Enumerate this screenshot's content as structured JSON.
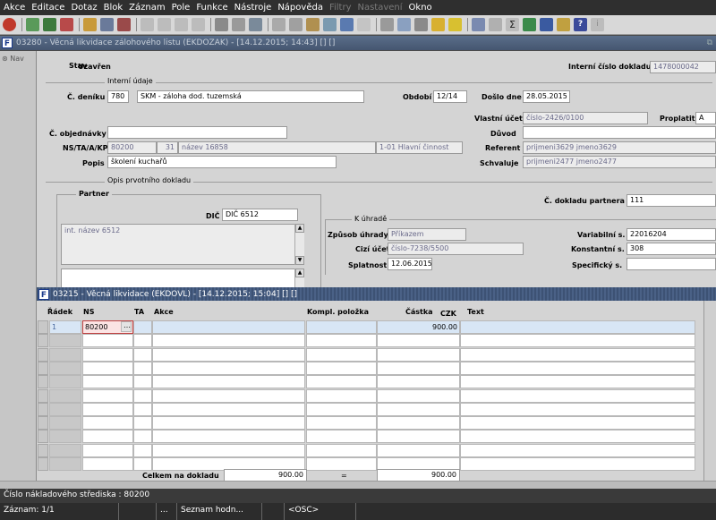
{
  "menu": [
    "Akce",
    "Editace",
    "Dotaz",
    "Blok",
    "Záznam",
    "Pole",
    "Funkce",
    "Nástroje",
    "Nápověda",
    "Filtry",
    "Nastavení",
    "Okno"
  ],
  "menu_disabled": [
    "Filtry",
    "Nastavení"
  ],
  "outer_window": {
    "title": "03280 - Věcná likvidace zálohového listu (EKDOZAK) - [14.12.2015; 14:43] [] []"
  },
  "nav": {
    "label": "Nav"
  },
  "form": {
    "stav_label": "Stav",
    "stav_value": "Uzavřen",
    "interni_cislo_label": "Interní číslo dokladu",
    "interni_cislo_value": "1478000042",
    "interni_udaje_label": "Interní údaje",
    "cislo_deniku_label": "Č. deníku",
    "cislo_deniku_value": "780",
    "denik_nazev": "SKM - záloha dod. tuzemská",
    "obdobi_label": "Období",
    "obdobi_value": "12/14",
    "doslo_dne_label": "Došlo dne",
    "doslo_dne_value": "28.05.2015",
    "vlastni_ucet_label": "Vlastní účet",
    "vlastni_ucet_value": "číslo-2426/0100",
    "proplatit_label": "Proplatit",
    "proplatit_value": "A",
    "objednavky_label": "Č. objednávky",
    "objednavky_value": "",
    "duvod_label": "Důvod",
    "duvod_value": "",
    "ns_label": "NS/TA/A/KP",
    "ns_value": "80200",
    "ta_value": "31",
    "a_value": "název 16858",
    "kp_value": "1-01 Hlavní činnost",
    "referent_label": "Referent",
    "referent_value": "prijmeni3629 jmeno3629",
    "popis_label": "Popis",
    "popis_value": "školení kuchařů",
    "schvaluje_label": "Schvaluje",
    "schvaluje_value": "prijmeni2477 jmeno2477",
    "opis_label": "Opis prvotního dokladu",
    "partner_label": "Partner",
    "cislo_partnera_label": "Č. dokladu partnera",
    "cislo_partnera_value": "111",
    "dic_label": "DIČ",
    "dic_value": "DIČ 6512",
    "partner_nazev": "int. název 6512",
    "k_uhrade_label": "K úhradě",
    "zpusob_label": "Způsob úhrady",
    "zpusob_value": "Příkazem",
    "cizi_ucet_label": "Cizí účet",
    "cizi_ucet_value": "číslo-7238/5500",
    "splatnost_label": "Splatnost",
    "splatnost_value": "12.06.2015",
    "variabilni_label": "Variabilní s.",
    "variabilni_value": "22016204",
    "konstantni_label": "Konstantní s.",
    "konstantni_value": "308",
    "specificky_label": "Specifický s.",
    "specificky_value": ""
  },
  "inner_window": {
    "title": "03215 - Věcná likvidace (EKDOVL) - [14.12.2015; 15:04] [] []",
    "columns": {
      "radek": "Řádek",
      "ns": "NS",
      "ta": "TA",
      "akce": "Akce",
      "kompl": "Kompl. položka",
      "castka": "Částka",
      "mena": "CZK",
      "text": "Text"
    },
    "first_row": {
      "radek": "1",
      "ns": "80200",
      "castka": "900.00"
    },
    "celkem_label": "Celkem na dokladu",
    "celkem_value": "900.00",
    "equals": "=",
    "celkem_value2": "900.00"
  },
  "status": {
    "line1": "Číslo nákladového střediska : 80200",
    "record": "Záznam: 1/1",
    "dots": "...",
    "list": "Seznam hodn...",
    "osc": "<OSC>"
  },
  "colors": {
    "menubar": "#2f2f2f",
    "title_bar": "#455670",
    "form_bg": "#d4d4d4",
    "selected_row": "#d8e6f5"
  }
}
